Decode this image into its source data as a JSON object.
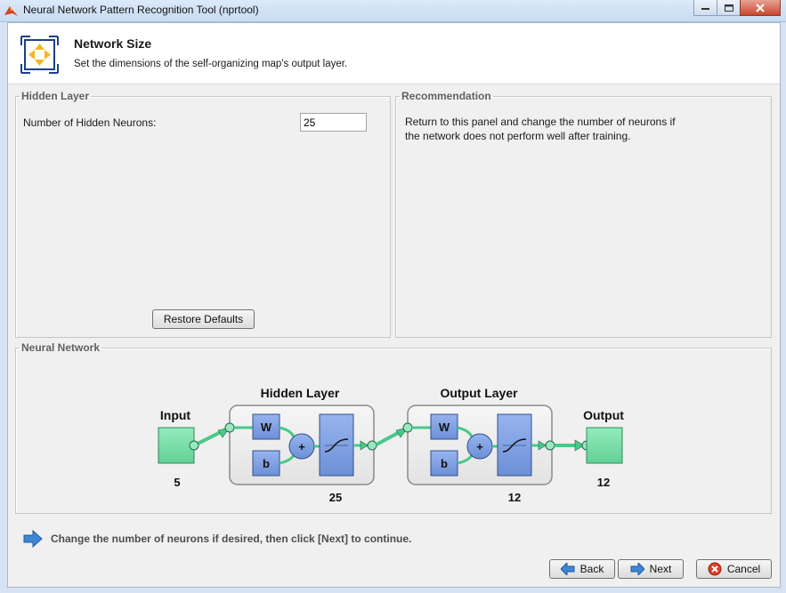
{
  "window": {
    "title": "Neural Network Pattern Recognition Tool (nprtool)",
    "controls": {
      "minimize": "minimize-icon",
      "maximize": "maximize-icon",
      "close": "close-icon"
    }
  },
  "header": {
    "title": "Network Size",
    "subtitle": "Set the dimensions of the self-organizing map's output layer."
  },
  "hidden_layer_panel": {
    "legend": "Hidden Layer",
    "neurons_label": "Number of Hidden Neurons:",
    "neurons_value": "25",
    "restore_defaults_label": "Restore Defaults"
  },
  "recommendation_panel": {
    "legend": "Recommendation",
    "line1": "Return to this panel and change the number of neurons if",
    "line2": "the network does not perform well after training."
  },
  "neural_network_panel": {
    "legend": "Neural Network",
    "input_label": "Input",
    "input_size": "5",
    "hidden_title": "Hidden Layer",
    "hidden_size": "25",
    "output_layer_title": "Output Layer",
    "output_layer_size": "12",
    "output_label": "Output",
    "output_size": "12",
    "weight_label": "W",
    "bias_label": "b",
    "sum_label": "+"
  },
  "footer": {
    "hint": "Change the number of neurons if desired, then click [Next] to continue.",
    "back_label": "Back",
    "next_label": "Next",
    "cancel_label": "Cancel"
  },
  "colors": {
    "node_fill": "#79e0a9",
    "block_fill": "#7d9fdf",
    "connector": "#47c98a",
    "layer_box": "#f0f0f0"
  }
}
